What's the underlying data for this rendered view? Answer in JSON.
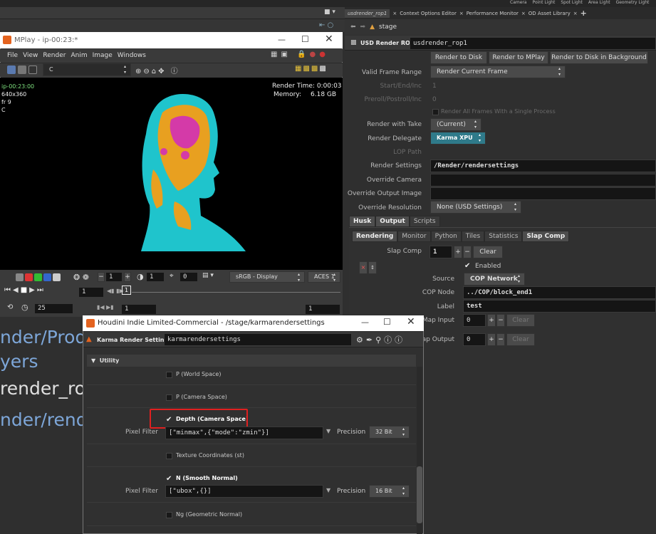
{
  "shelf": {
    "items": [
      "Camera",
      "Point Light",
      "Spot Light",
      "Area Light",
      "Geometry Light"
    ]
  },
  "pane_tabs": {
    "tabs": [
      "usdrender_rop1",
      "Context Options Editor",
      "Performance Monitor",
      "OD Asset Library"
    ],
    "path": "stage"
  },
  "rop": {
    "type_label": "USD Render ROP",
    "name": "usdrender_rop1",
    "buttons": [
      "Render to Disk",
      "Render to MPlay",
      "Render to Disk in Background"
    ],
    "valid_frame_range_label": "Valid Frame Range",
    "valid_frame_range": "Render Current Frame",
    "start_end_label": "Start/End/Inc",
    "start_val": "1",
    "preroll_label": "Preroll/Postroll/Inc",
    "preroll_val": "0",
    "render_all_frames": "Render All Frames With a Single Process",
    "render_with_take_label": "Render with Take",
    "render_with_take": "(Current)",
    "render_delegate_label": "Render Delegate",
    "render_delegate": "Karma XPU",
    "lop_path_label": "LOP Path",
    "render_settings_label": "Render Settings",
    "render_settings": "/Render/rendersettings",
    "override_camera_label": "Override Camera",
    "override_output_label": "Override Output Image",
    "override_res_label": "Override Resolution",
    "override_res": "None (USD Settings)",
    "tabs1": [
      "Husk",
      "Output",
      "Scripts"
    ],
    "tabs2": [
      "Rendering",
      "Monitor",
      "Python",
      "Tiles",
      "Statistics",
      "Slap Comp"
    ],
    "slap_comp_label": "Slap Comp",
    "slap_comp_val": "1",
    "clear": "Clear",
    "enabled": "Enabled",
    "source_label": "Source",
    "source": "COP Network",
    "cop_node_label": "COP Node",
    "cop_node": "../COP/block_end1",
    "label_label": "Label",
    "label_val": "test",
    "map_input_label": "Map Input",
    "map_input": "0",
    "map_output_label": "Map Output",
    "map_output": "0"
  },
  "mplay": {
    "title": "MPlay - ip-00:23:*",
    "menu": [
      "File",
      "View",
      "Render",
      "Anim",
      "Image",
      "Windows"
    ],
    "channel": "C",
    "info": [
      "ip-00:23:00",
      "640x360",
      "fr 9",
      "C"
    ],
    "render_time": "Render Time: 0:00:03",
    "memory_label": "Memory:",
    "memory": "6.18 GB",
    "frame_a": "1",
    "frame_b": "1",
    "frame_c": "0",
    "colorspace": "sRGB - Display",
    "aces": "ACES 1",
    "frame_field": "1",
    "frame_marker": "1",
    "fps": "25",
    "start": "1",
    "end": "1"
  },
  "bg_text": [
    "nder/Produ",
    "yers",
    "render_ro",
    "nder/rende"
  ],
  "karma": {
    "title": "Houdini Indie Limited-Commercial - /stage/karmarendersettings",
    "type_label": "Karma Render Settings",
    "name": "karmarendersettings",
    "section": "Utility",
    "aovs": [
      {
        "label": "P (World Space)",
        "checked": false
      },
      {
        "label": "P (Camera Space)",
        "checked": false
      },
      {
        "label": "Depth (Camera Space)",
        "checked": true,
        "filter": "[\"minmax\",{\"mode\":\"zmin\"}]",
        "precision": "32 Bit"
      },
      {
        "label": "Texture Coordinates (st)",
        "checked": false
      },
      {
        "label": "N (Smooth Normal)",
        "checked": true,
        "filter": "[\"ubox\",{}]",
        "precision": "16 Bit"
      },
      {
        "label": "Ng (Geometric Normal)",
        "checked": false
      }
    ],
    "pixel_filter_label": "Pixel Filter",
    "precision_label": "Precision"
  },
  "colors": {
    "highlight": "#e02020",
    "face_cyan": "#1fc4cc",
    "face_orange": "#e8a020",
    "face_magenta": "#d43aa8"
  }
}
